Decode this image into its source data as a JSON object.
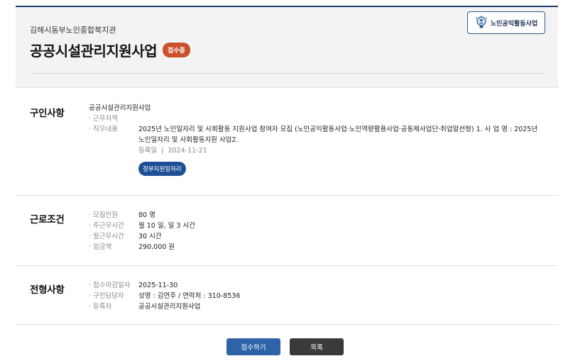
{
  "header": {
    "org": "김해시동부노인종합복지관",
    "title": "공공시설관리지원사업",
    "status_badge": "접수중",
    "logo_text": "노인공익활동사업",
    "logo_icon": "lightbulb-person-icon"
  },
  "job": {
    "section_title": "구인사항",
    "job_name": "공공시설관리지원사업",
    "area_label": "근무지역",
    "area_value": "",
    "duty_label": "직무내용",
    "duty_value": "2025년 노인일자리 및 사회활동 지원사업 참여자 모집 (노인공익활동사업·노인역량활용사업·공동체사업단·취업알선형)  1. 사 업 명 : 2025년 노인일자리 및 사회활동지원 사업2.",
    "reg_date_label": "등록일",
    "reg_date_value": "2024-11-21",
    "tag": "정부지원일자리"
  },
  "conditions": {
    "section_title": "근로조건",
    "rows": [
      {
        "label": "모집인원",
        "value": "80 명"
      },
      {
        "label": "주근무시간",
        "value": "월 10 일, 일 3 시간"
      },
      {
        "label": "월근무시간",
        "value": "30 시간"
      },
      {
        "label": "임금액",
        "value": "290,000 원"
      }
    ]
  },
  "selection": {
    "section_title": "전형사항",
    "rows": [
      {
        "label": "접수마감일자",
        "value": "2025-11-30"
      },
      {
        "label": "구인담당자",
        "value": "성명 : 김연주 / 연락처 : 310-8536"
      },
      {
        "label": "등록자",
        "value": "공공시설관리지원사업"
      }
    ]
  },
  "buttons": {
    "apply": "접수하기",
    "list": "목록"
  },
  "colors": {
    "badge": "#c9502a",
    "tag": "#1e4f95",
    "apply_button": "#2e63a8",
    "list_button": "#3a3a3a"
  }
}
